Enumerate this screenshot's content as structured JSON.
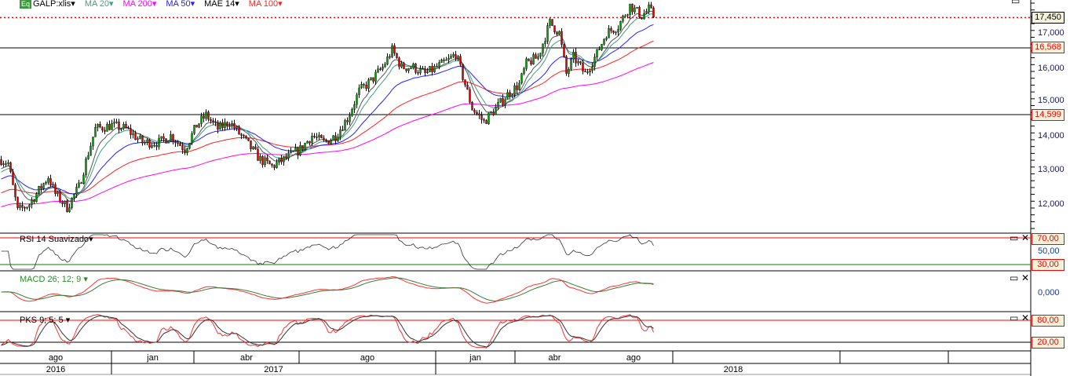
{
  "header": {
    "badge": "Eq",
    "symbol": "GALP:xlis",
    "legend": [
      {
        "label": "MA 20",
        "color": "#3f9f7f"
      },
      {
        "label": "MA 200",
        "color": "#ff00ff"
      },
      {
        "label": "MA 50",
        "color": "#2020ff"
      },
      {
        "label": "MAE 14",
        "color": "#000000"
      },
      {
        "label": "MA 100",
        "color": "#ff2020"
      }
    ]
  },
  "price_axis": {
    "ticks": [
      "17,000",
      "16,000",
      "15,000",
      "14,000",
      "13,000",
      "12,000"
    ],
    "tags": {
      "last": "17,450",
      "line1": "16,568",
      "line2": "14,599"
    }
  },
  "panels": {
    "rsi": {
      "label": "RSI 14 Suavizado",
      "levels": [
        "70,00",
        "50,00",
        "30,00"
      ]
    },
    "macd": {
      "label": "MACD 26; 12; 9",
      "zero": "0,000"
    },
    "pks": {
      "label": "PKS 9; 5; 5",
      "levels": [
        "80,00",
        "20,00"
      ]
    }
  },
  "time_axis": {
    "months": [
      "ago",
      "jan",
      "abr",
      "ago",
      "jan",
      "abr",
      "ago"
    ],
    "years": [
      "2016",
      "2017",
      "2018"
    ]
  },
  "chart_data": {
    "type": "candlestick",
    "title": "GALP:xlis",
    "y_range": [
      11.5,
      17.9
    ],
    "horizontal_lines": [
      17.45,
      16.568,
      14.599
    ],
    "price_path_bar_index": [
      [
        0,
        13.3
      ],
      [
        3,
        13.2
      ],
      [
        7,
        11.8
      ],
      [
        12,
        12.0
      ],
      [
        17,
        12.5
      ],
      [
        20,
        12.8
      ],
      [
        23,
        12.3
      ],
      [
        28,
        11.9
      ],
      [
        33,
        12.5
      ],
      [
        37,
        13.5
      ],
      [
        40,
        14.2
      ],
      [
        47,
        14.3
      ],
      [
        53,
        14.2
      ],
      [
        60,
        13.8
      ],
      [
        67,
        13.8
      ],
      [
        72,
        14.0
      ],
      [
        78,
        13.6
      ],
      [
        83,
        14.3
      ],
      [
        87,
        14.6
      ],
      [
        92,
        14.2
      ],
      [
        97,
        14.4
      ],
      [
        103,
        13.9
      ],
      [
        110,
        13.3
      ],
      [
        115,
        13.1
      ],
      [
        120,
        13.3
      ],
      [
        127,
        13.6
      ],
      [
        132,
        14.0
      ],
      [
        137,
        13.8
      ],
      [
        142,
        14.0
      ],
      [
        147,
        14.5
      ],
      [
        152,
        15.3
      ],
      [
        157,
        15.6
      ],
      [
        162,
        16.0
      ],
      [
        166,
        16.5
      ],
      [
        170,
        16.0
      ],
      [
        175,
        16.0
      ],
      [
        180,
        15.8
      ],
      [
        185,
        16.0
      ],
      [
        190,
        16.2
      ],
      [
        193,
        16.4
      ],
      [
        197,
        15.5
      ],
      [
        200,
        14.8
      ],
      [
        205,
        14.4
      ],
      [
        210,
        14.8
      ],
      [
        215,
        15.2
      ],
      [
        220,
        15.5
      ],
      [
        223,
        16.1
      ],
      [
        228,
        16.3
      ],
      [
        233,
        17.3
      ],
      [
        237,
        17.0
      ],
      [
        240,
        15.8
      ],
      [
        243,
        16.3
      ],
      [
        248,
        15.8
      ],
      [
        253,
        16.4
      ],
      [
        257,
        17.0
      ],
      [
        262,
        17.2
      ],
      [
        267,
        17.8
      ],
      [
        272,
        17.5
      ],
      [
        275,
        17.7
      ],
      [
        277,
        17.5
      ]
    ],
    "moving_average_start": {
      "ma20": 12.9,
      "ma50": 12.7,
      "ma100": 12.3,
      "ma200": 11.9,
      "mae14": 13.0
    }
  }
}
